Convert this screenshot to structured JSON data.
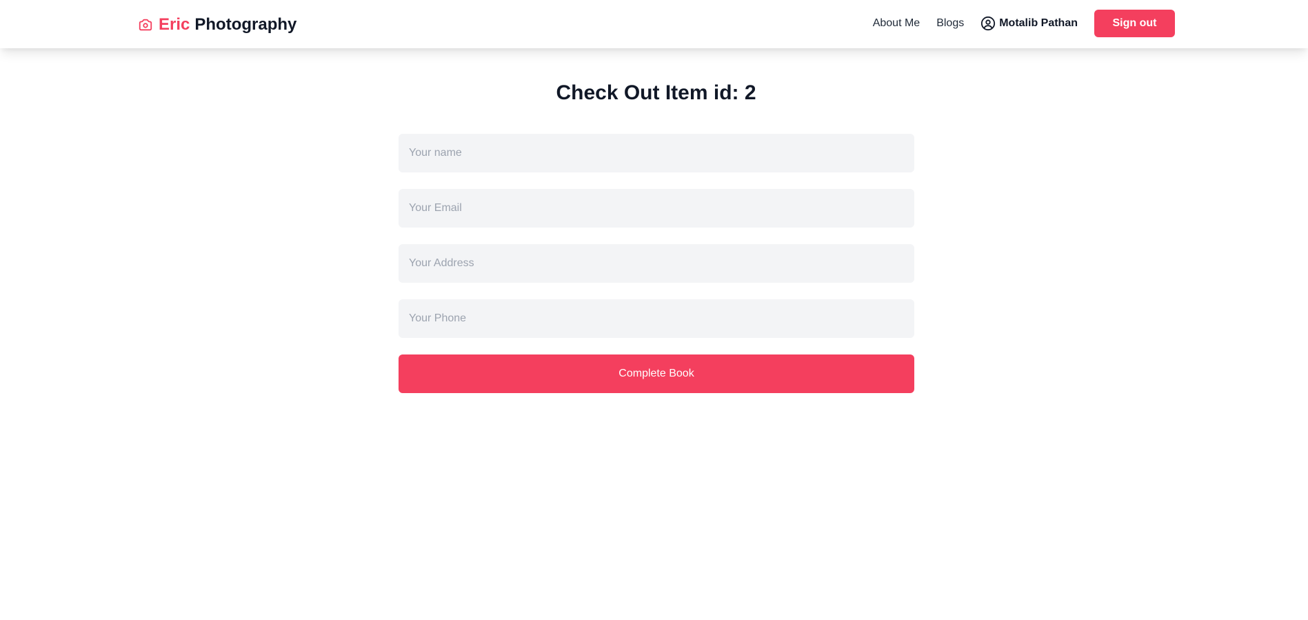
{
  "brand": {
    "icon": "camera-icon",
    "first": "Eric",
    "second": "Photography",
    "accent_color": "#f43f5e"
  },
  "nav": {
    "links": [
      "About Me",
      "Blogs"
    ],
    "user_icon": "user-circle-icon",
    "user_name": "Motalib Pathan",
    "signout_label": "Sign out"
  },
  "checkout": {
    "title": "Check Out Item id: 2",
    "fields": [
      {
        "placeholder": "Your name",
        "value": ""
      },
      {
        "placeholder": "Your Email",
        "value": ""
      },
      {
        "placeholder": "Your Address",
        "value": ""
      },
      {
        "placeholder": "Your Phone",
        "value": ""
      }
    ],
    "submit_label": "Complete Book"
  },
  "colors": {
    "accent": "#f43f5e",
    "input_bg": "#f3f4f6",
    "text": "#111827",
    "placeholder": "#9ca3af"
  }
}
